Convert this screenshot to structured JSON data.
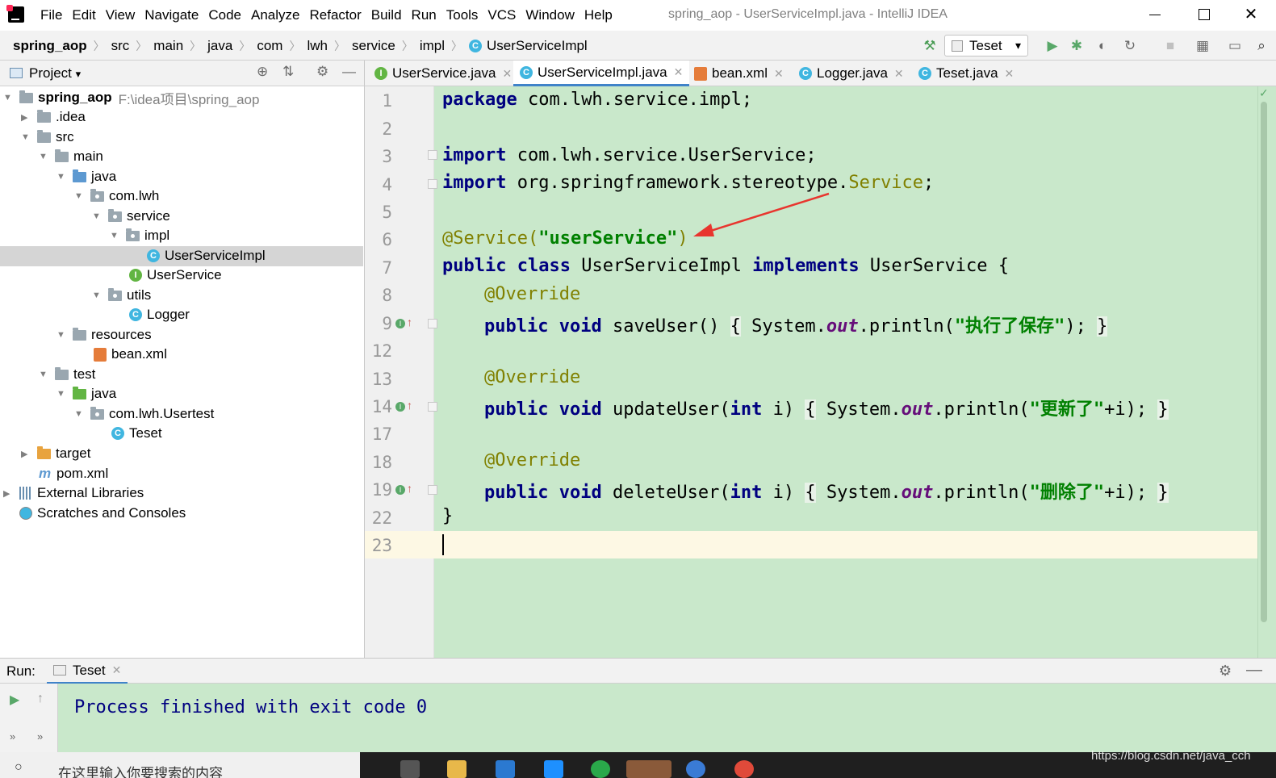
{
  "window": {
    "title": "spring_aop - UserServiceImpl.java - IntelliJ IDEA",
    "close_glyph": "✕"
  },
  "menu": [
    "File",
    "Edit",
    "View",
    "Navigate",
    "Code",
    "Analyze",
    "Refactor",
    "Build",
    "Run",
    "Tools",
    "VCS",
    "Window",
    "Help"
  ],
  "breadcrumb": [
    "spring_aop",
    "src",
    "main",
    "java",
    "com",
    "lwh",
    "service",
    "impl",
    "UserServiceImpl"
  ],
  "breadcrumb_sep": "〉",
  "toolbar": {
    "run_config": "Teset",
    "icons": {
      "hammer": "⚒",
      "play": "▶",
      "debug": "✱",
      "coverage": "◐",
      "profile": "↻",
      "stop": "■",
      "structure": "▦",
      "terminal": "▭",
      "search": "⌕"
    }
  },
  "project_panel": {
    "title": "Project",
    "title_arrow": "▾",
    "header_icons": {
      "locate": "⊕",
      "collapse": "⇅",
      "settings": "⚙",
      "hide": "—"
    },
    "tree": [
      {
        "label": "spring_aop",
        "path": "F:\\idea项目\\spring_aop"
      },
      {
        "label": ".idea"
      },
      {
        "label": "src"
      },
      {
        "label": "main"
      },
      {
        "label": "java"
      },
      {
        "label": "com.lwh"
      },
      {
        "label": "service"
      },
      {
        "label": "impl"
      },
      {
        "label": "UserServiceImpl"
      },
      {
        "label": "UserService"
      },
      {
        "label": "utils"
      },
      {
        "label": "Logger"
      },
      {
        "label": "resources"
      },
      {
        "label": "bean.xml"
      },
      {
        "label": "test"
      },
      {
        "label": "java"
      },
      {
        "label": "com.lwh.Usertest"
      },
      {
        "label": "Teset"
      },
      {
        "label": "target"
      },
      {
        "label": "pom.xml"
      },
      {
        "label": "External Libraries"
      },
      {
        "label": "Scratches and Consoles"
      }
    ],
    "glyphs": {
      "expanded": "▼",
      "collapsed": "▶",
      "class_letter": "C",
      "interface_letter": "I",
      "maven_letter": "m"
    }
  },
  "editor": {
    "tabs": [
      "UserService.java",
      "UserServiceImpl.java",
      "bean.xml",
      "Logger.java",
      "Teset.java"
    ],
    "active_tab": "UserServiceImpl.java",
    "tab_close": "✕",
    "line_numbers": [
      "1",
      "2",
      "3",
      "4",
      "5",
      "6",
      "7",
      "8",
      "9",
      "12",
      "13",
      "14",
      "17",
      "18",
      "19",
      "22",
      "23"
    ],
    "code": {
      "l1_kw": "package",
      "l1_rest": " com.lwh.service.impl;",
      "l3_kw": "import",
      "l3_rest": " com.lwh.service.UserService;",
      "l4_kw": "import",
      "l4_rest": " org.springframework.stereotype.",
      "l4_svc": "Service",
      "l4_end": ";",
      "l6_ann": "@Service(",
      "l6_str": "\"userService\"",
      "l6_end": ")",
      "l7_kw1": "public class",
      "l7_name": " UserServiceImpl ",
      "l7_kw2": "implements",
      "l7_rest": " UserService {",
      "override": "@Override",
      "l9_kw": "public void",
      "l9_sig": " saveUser() ",
      "l9_ob": "{",
      "l9_sys": " System.",
      "l9_out": "out",
      "l9_print": ".println(",
      "l9_str": "\"执行了保存\"",
      "l9_end": "); ",
      "l9_cb": "}",
      "l14_kw": "public void",
      "l14_sig": " updateUser(",
      "l14_int": "int",
      "l14_i": " i) ",
      "l14_ob": "{",
      "l14_sys": " System.",
      "l14_out": "out",
      "l14_print": ".println(",
      "l14_str": "\"更新了\"",
      "l14_end": "+i); ",
      "l14_cb": "}",
      "l19_kw": "public void",
      "l19_sig": " deleteUser(",
      "l19_int": "int",
      "l19_i": " i) ",
      "l19_ob": "{",
      "l19_sys": " System.",
      "l19_out": "out",
      "l19_print": ".println(",
      "l19_str": "\"删除了\"",
      "l19_end": "+i); ",
      "l19_cb": "}",
      "l22": "}"
    },
    "gutter_marker_o": "I",
    "gutter_marker_up": "↑",
    "status_check": "✓"
  },
  "run_panel": {
    "label": "Run:",
    "tab": "Teset",
    "tab_close": "✕",
    "output": "Process finished with exit code 0",
    "icons": {
      "rerun": "▶",
      "up": "↑",
      "more": "»",
      "gear": "⚙",
      "hide": "—"
    }
  },
  "taskbar": {
    "search_placeholder": "在这里输入你要搜索的内容",
    "search_icon": "○"
  },
  "watermark": "https://blog.csdn.net/java_cch",
  "colors": {
    "code_bg": "#c9e8cb",
    "accent": "#4083c9",
    "annotation_arrow": "#e8352e"
  }
}
